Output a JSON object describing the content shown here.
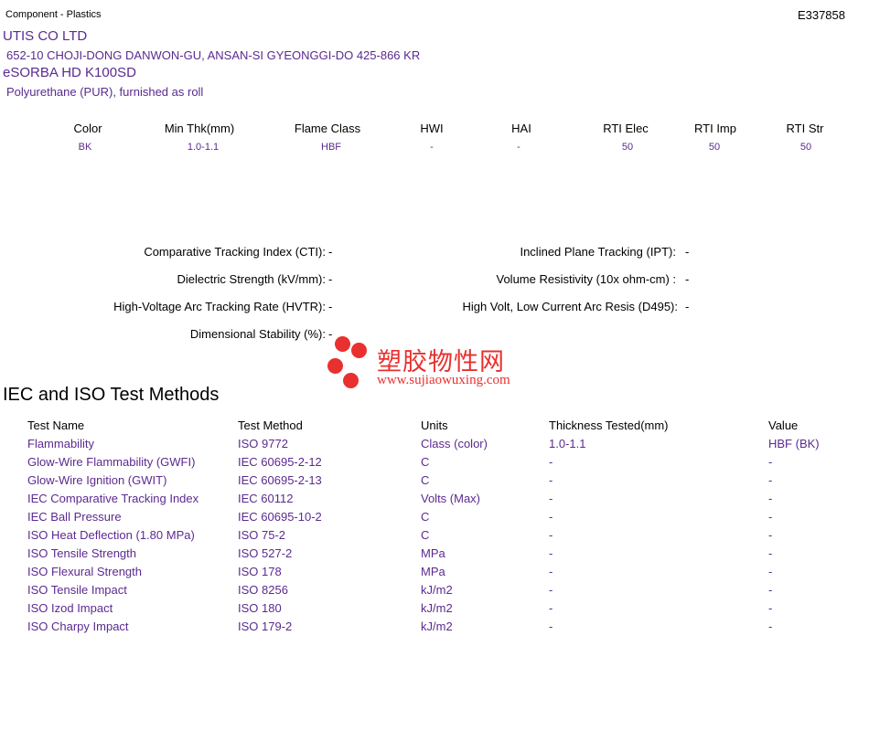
{
  "header": {
    "category": "Component - Plastics",
    "file_no": "E337858"
  },
  "company": {
    "name": "UTIS CO LTD",
    "address": "652-10 CHOJI-DONG DANWON-GU, ANSAN-SI  GYEONGGI-DO  425-866 KR"
  },
  "product": {
    "name": "eSORBA HD K100SD",
    "description": "Polyurethane (PUR), furnished as roll"
  },
  "properties": {
    "headers": [
      "Color",
      "Min Thk(mm)",
      "Flame Class",
      "HWI",
      "HAI",
      "RTI Elec",
      "RTI Imp",
      "RTI Str"
    ],
    "values": [
      "BK",
      "1.0-1.1",
      "HBF",
      "-",
      "-",
      "50",
      "50",
      "50"
    ]
  },
  "electrical": {
    "left": [
      {
        "label": "Comparative Tracking Index (CTI):",
        "value": "-"
      },
      {
        "label": "Dielectric Strength (kV/mm):",
        "value": "-"
      },
      {
        "label": "High-Voltage Arc Tracking Rate (HVTR):",
        "value": "-"
      },
      {
        "label": "Dimensional Stability (%):",
        "value": "-"
      }
    ],
    "right": [
      {
        "label": "Inclined Plane Tracking (IPT):",
        "value": "-"
      },
      {
        "label": "Volume Resistivity (10x ohm-cm) :",
        "value": "-"
      },
      {
        "label": "High Volt, Low Current Arc Resis (D495):",
        "value": "-"
      }
    ]
  },
  "watermark": {
    "cn": "塑胶物性网",
    "url": "www.sujiaowuxing.com"
  },
  "tests": {
    "title": "IEC and ISO Test Methods",
    "headers": [
      "Test Name",
      "Test Method",
      "Units",
      "Thickness Tested(mm)",
      "Value"
    ],
    "rows": [
      [
        "Flammability",
        "ISO 9772",
        "Class (color)",
        "1.0-1.1",
        "HBF (BK)"
      ],
      [
        "Glow-Wire Flammability (GWFI)",
        "IEC 60695-2-12",
        "C",
        "-",
        "-"
      ],
      [
        "Glow-Wire Ignition (GWIT)",
        "IEC 60695-2-13",
        "C",
        "-",
        "-"
      ],
      [
        "IEC Comparative Tracking Index",
        "IEC 60112",
        "Volts (Max)",
        "-",
        "-"
      ],
      [
        "IEC Ball Pressure",
        "IEC 60695-10-2",
        "C",
        "-",
        "-"
      ],
      [
        "ISO Heat Deflection (1.80 MPa)",
        "ISO 75-2",
        "C",
        "-",
        "-"
      ],
      [
        "ISO Tensile Strength",
        "ISO 527-2",
        "MPa",
        "-",
        "-"
      ],
      [
        "ISO Flexural Strength",
        "ISO 178",
        "MPa",
        "-",
        "-"
      ],
      [
        "ISO Tensile Impact",
        "ISO 8256",
        "kJ/m2",
        "-",
        "-"
      ],
      [
        "ISO Izod Impact",
        "ISO 180",
        "kJ/m2",
        "-",
        "-"
      ],
      [
        "ISO Charpy Impact",
        "ISO 179-2",
        "kJ/m2",
        "-",
        "-"
      ]
    ]
  }
}
